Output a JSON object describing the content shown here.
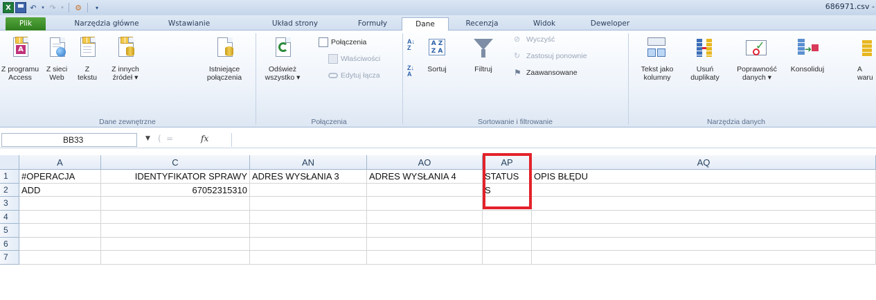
{
  "title_bar": {
    "filename": "686971.csv -",
    "quick_access": [
      "excel-logo-icon",
      "save-icon",
      "undo-icon",
      "redo-icon",
      "customize-icon"
    ]
  },
  "tabs": [
    {
      "label": "Plik"
    },
    {
      "label": "Narzędzia główne"
    },
    {
      "label": "Wstawianie"
    },
    {
      "label": "Układ strony"
    },
    {
      "label": "Formuły"
    },
    {
      "label": "Dane"
    },
    {
      "label": "Recenzja"
    },
    {
      "label": "Widok"
    },
    {
      "label": "Deweloper"
    }
  ],
  "active_tab": "Dane",
  "ribbon": {
    "external_data": {
      "group_label": "Dane zewnętrzne",
      "buttons": [
        {
          "line1": "Z programu",
          "line2": "Access",
          "icon": "access-icon"
        },
        {
          "line1": "Z sieci",
          "line2": "Web",
          "icon": "web-icon"
        },
        {
          "line1": "Z",
          "line2": "tekstu",
          "icon": "text-file-icon"
        },
        {
          "line1": "Z innych",
          "line2": "źródeł ▾",
          "icon": "other-sources-icon"
        },
        {
          "line1": "Istniejące",
          "line2": "połączenia",
          "icon": "existing-connections-icon"
        }
      ]
    },
    "connections": {
      "group_label": "Połączenia",
      "refresh": {
        "line1": "Odśwież",
        "line2": "wszystko ▾"
      },
      "small": [
        {
          "label": "Połączenia",
          "enabled": true
        },
        {
          "label": "Właściwości",
          "enabled": false
        },
        {
          "label": "Edytuj łącza",
          "enabled": false
        }
      ]
    },
    "sort_filter": {
      "group_label": "Sortowanie i filtrowanie",
      "sort_label": "Sortuj",
      "filter_label": "Filtruj",
      "clear_label": "Wyczyść",
      "reapply_label": "Zastosuj ponownie",
      "advanced_label": "Zaawansowane"
    },
    "data_tools": {
      "group_label": "Narzędzia danych",
      "buttons": [
        {
          "line1": "Tekst jako",
          "line2": "kolumny"
        },
        {
          "line1": "Usuń",
          "line2": "duplikaty"
        },
        {
          "line1": "Poprawność",
          "line2": "danych ▾"
        },
        {
          "line1": "Konsoliduj",
          "line2": ""
        },
        {
          "line1": "A",
          "line2": "waru"
        }
      ]
    }
  },
  "formula_bar": {
    "name_box": "BB33",
    "fx": "fx",
    "value": ""
  },
  "sheet": {
    "columns": [
      "A",
      "C",
      "AN",
      "AO",
      "AP",
      "AQ"
    ],
    "rows": [
      "1",
      "2",
      "3",
      "4",
      "5",
      "6",
      "7"
    ],
    "cells": [
      [
        "#OPERACJA",
        "IDENTYFIKATOR SPRAWY",
        "ADRES WYSŁANIA 3",
        "ADRES WYSŁANIA 4",
        "STATUS",
        "OPIS BŁĘDU"
      ],
      [
        "ADD",
        "67052315310",
        "",
        "",
        "S",
        ""
      ],
      [
        "",
        "",
        "",
        "",
        "",
        ""
      ],
      [
        "",
        "",
        "",
        "",
        "",
        ""
      ],
      [
        "",
        "",
        "",
        "",
        "",
        ""
      ],
      [
        "",
        "",
        "",
        "",
        "",
        ""
      ],
      [
        "",
        "",
        "",
        "",
        "",
        ""
      ]
    ]
  },
  "colors": {
    "highlight": "#e3222a",
    "file_tab": "#3e8f2b",
    "ribbon_bg": "#eef3fa"
  }
}
